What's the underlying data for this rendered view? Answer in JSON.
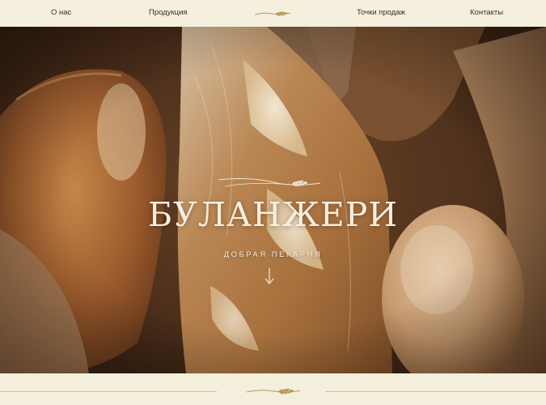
{
  "nav": {
    "items": [
      {
        "label": "О нас"
      },
      {
        "label": "Продукция"
      },
      {
        "label": "Точки продаж"
      },
      {
        "label": "Контакты"
      }
    ],
    "logo_icon": "wheat-sprig-icon"
  },
  "hero": {
    "title": "БУЛАНЖЕРИ",
    "subtitle": "ДОБРАЯ ПЕКАРНЯ",
    "ornament_icon": "wheat-ornament-icon",
    "scroll_icon": "arrow-down-icon"
  },
  "footer": {
    "ornament_icon": "wheat-sprig-icon"
  },
  "colors": {
    "background": "#f4f0dd",
    "nav_text": "#3a2e1f",
    "hero_text": "#f6efe2",
    "ornament": "#b59a5a"
  }
}
